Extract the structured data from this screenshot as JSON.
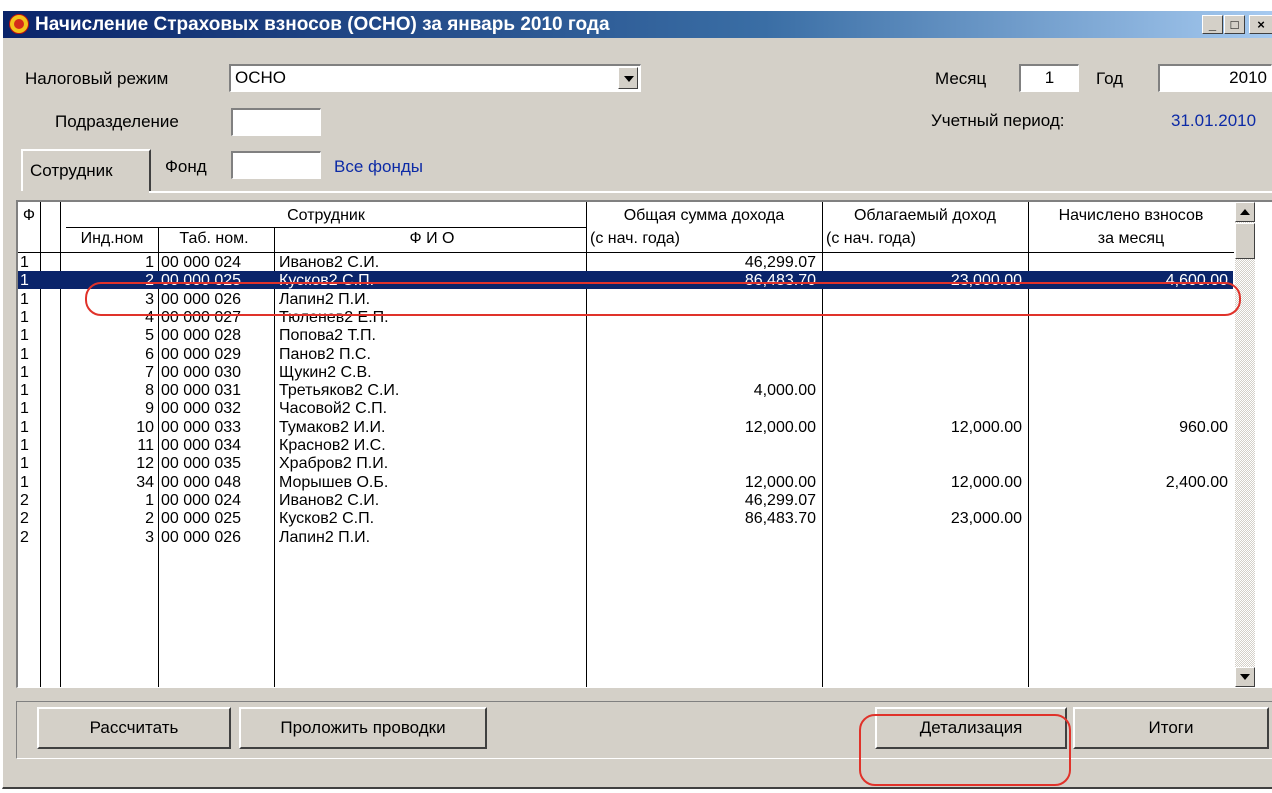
{
  "window": {
    "title": "Начисление Страховых взносов (ОСНО) за январь 2010 года",
    "controls": {
      "minimize": "_",
      "maximize": "□",
      "close": "×"
    }
  },
  "form": {
    "tax_mode_label": "Налоговый режим",
    "tax_mode_value": "ОСНО",
    "division_label": "Подразделение",
    "division_value": "",
    "month_label": "Месяц",
    "month_value": "1",
    "year_label": "Год",
    "year_value": "2010",
    "period_label": "Учетный период:",
    "period_value": "31.01.2010"
  },
  "tabs": {
    "employee_tab": "Сотрудник",
    "fund_label": "Фонд",
    "fund_value": "",
    "all_funds": "Все фонды"
  },
  "grid": {
    "headers": {
      "f": "Ф",
      "employee_group": "Сотрудник",
      "ind": "Инд.ном",
      "tab": "Таб. ном.",
      "fio": "Ф И О",
      "total_income_1": "Общая сумма дохода",
      "total_income_2": "(с нач. года)",
      "taxable_1": "Облагаемый доход",
      "taxable_2": "(с нач. года)",
      "accrued_1": "Начислено взносов",
      "accrued_2": "за месяц"
    },
    "rows": [
      {
        "f": "1",
        "ind": "1",
        "tab": "00 000 024",
        "fio": "Иванов2 С.И.",
        "income": "46,299.07",
        "taxable": "",
        "accrued": ""
      },
      {
        "f": "1",
        "ind": "2",
        "tab": "00 000 025",
        "fio": "Кусков2 С.П.",
        "income": "86,483.70",
        "taxable": "23,000.00",
        "accrued": "4,600.00",
        "selected": true
      },
      {
        "f": "1",
        "ind": "3",
        "tab": "00 000 026",
        "fio": "Лапин2 П.И.",
        "income": "",
        "taxable": "",
        "accrued": ""
      },
      {
        "f": "1",
        "ind": "4",
        "tab": "00 000 027",
        "fio": "Тюленев2 Е.П.",
        "income": "",
        "taxable": "",
        "accrued": ""
      },
      {
        "f": "1",
        "ind": "5",
        "tab": "00 000 028",
        "fio": "Попова2 Т.П.",
        "income": "",
        "taxable": "",
        "accrued": ""
      },
      {
        "f": "1",
        "ind": "6",
        "tab": "00 000 029",
        "fio": "Панов2 П.С.",
        "income": "",
        "taxable": "",
        "accrued": ""
      },
      {
        "f": "1",
        "ind": "7",
        "tab": "00 000 030",
        "fio": "Щукин2 С.В.",
        "income": "",
        "taxable": "",
        "accrued": ""
      },
      {
        "f": "1",
        "ind": "8",
        "tab": "00 000 031",
        "fio": "Третьяков2 С.И.",
        "income": "4,000.00",
        "taxable": "",
        "accrued": ""
      },
      {
        "f": "1",
        "ind": "9",
        "tab": "00 000 032",
        "fio": "Часовой2 С.П.",
        "income": "",
        "taxable": "",
        "accrued": ""
      },
      {
        "f": "1",
        "ind": "10",
        "tab": "00 000 033",
        "fio": "Тумаков2 И.И.",
        "income": "12,000.00",
        "taxable": "12,000.00",
        "accrued": "960.00"
      },
      {
        "f": "1",
        "ind": "11",
        "tab": "00 000 034",
        "fio": "Краснов2 И.С.",
        "income": "",
        "taxable": "",
        "accrued": ""
      },
      {
        "f": "1",
        "ind": "12",
        "tab": "00 000 035",
        "fio": "Храбров2 П.И.",
        "income": "",
        "taxable": "",
        "accrued": ""
      },
      {
        "f": "1",
        "ind": "34",
        "tab": "00 000 048",
        "fio": "Морышев О.Б.",
        "income": "12,000.00",
        "taxable": "12,000.00",
        "accrued": "2,400.00"
      },
      {
        "f": "2",
        "ind": "1",
        "tab": "00 000 024",
        "fio": "Иванов2 С.И.",
        "income": "46,299.07",
        "taxable": "",
        "accrued": ""
      },
      {
        "f": "2",
        "ind": "2",
        "tab": "00 000 025",
        "fio": "Кусков2 С.П.",
        "income": "86,483.70",
        "taxable": "23,000.00",
        "accrued": ""
      },
      {
        "f": "2",
        "ind": "3",
        "tab": "00 000 026",
        "fio": "Лапин2 П.И.",
        "income": "",
        "taxable": "",
        "accrued": ""
      }
    ]
  },
  "buttons": {
    "calculate": "Рассчитать",
    "post_entries": "Проложить проводки",
    "details": "Детализация",
    "totals": "Итоги"
  },
  "colors": {
    "selection": "#0a246a",
    "highlight": "#e0322a",
    "link": "#0c2aa6"
  }
}
